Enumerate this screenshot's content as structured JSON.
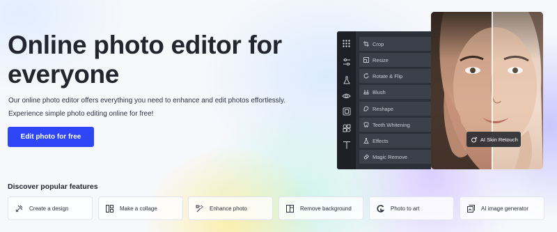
{
  "hero": {
    "title_line1": "Online photo editor for",
    "title_line2": "everyone",
    "desc_line1": "Our online photo editor offers everything you need to enhance and edit photos effortlessly.",
    "desc_line2": "Experience simple photo editing online for free!",
    "cta_label": "Edit photo for free",
    "cta_color": "#2e46f5"
  },
  "editor": {
    "toolbar_icons": [
      "grid-icon",
      "sliders-icon",
      "flask-icon",
      "eye-icon",
      "frame-icon",
      "shapes-icon",
      "text-icon"
    ],
    "menu_items": [
      {
        "label": "Crop",
        "icon": "crop-icon"
      },
      {
        "label": "Resize",
        "icon": "resize-icon"
      },
      {
        "label": "Rotate & Flip",
        "icon": "rotate-icon"
      },
      {
        "label": "Blush",
        "icon": "blush-icon"
      },
      {
        "label": "Reshape",
        "icon": "reshape-icon"
      },
      {
        "label": "Teeth Whitening",
        "icon": "teeth-icon"
      },
      {
        "label": "Effects",
        "icon": "effects-icon"
      },
      {
        "label": "Magic Remove",
        "icon": "eraser-icon"
      }
    ],
    "badge_label": "AI Skin Retouch"
  },
  "features": {
    "heading": "Discover popular features",
    "items": [
      {
        "label": "Create a design",
        "icon": "design-icon"
      },
      {
        "label": "Make a collage",
        "icon": "collage-icon"
      },
      {
        "label": "Enhance photo",
        "icon": "enhance-icon"
      },
      {
        "label": "Remove background",
        "icon": "remove-bg-icon"
      },
      {
        "label": "Photo to art",
        "icon": "art-icon"
      },
      {
        "label": "AI image generator",
        "icon": "ai-image-icon"
      }
    ]
  }
}
